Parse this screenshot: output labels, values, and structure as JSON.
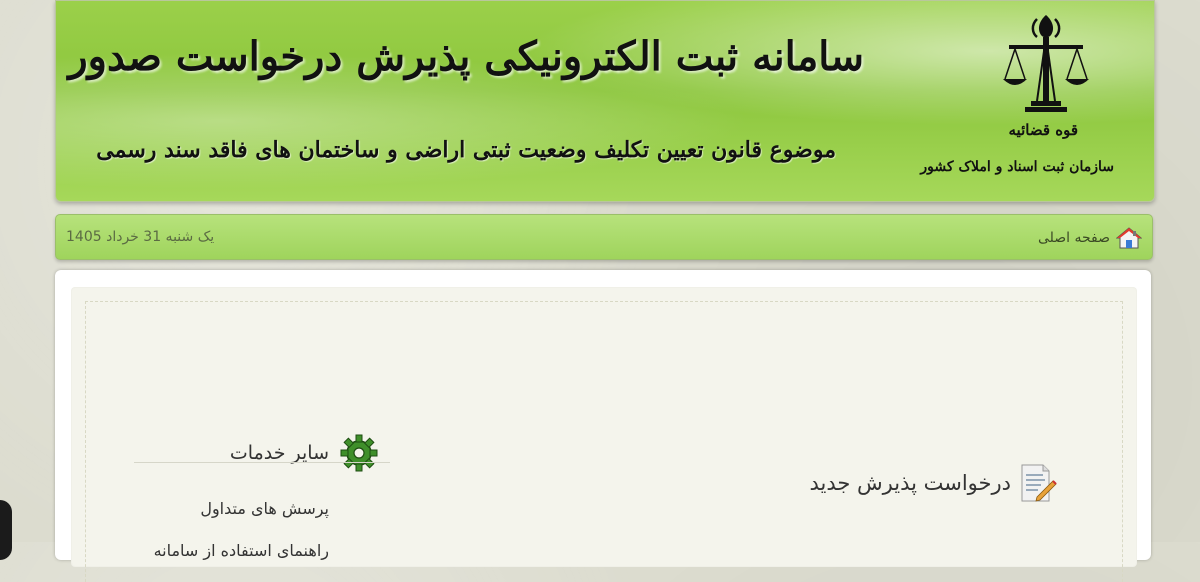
{
  "header": {
    "title": "سامانه ثبت الکترونیکی پذیرش درخواست صدور سند مالکیت",
    "subtitle": "موضوع قانون تعیین تکلیف وضعیت ثبتی اراضی و ساختمان های فاقد سند رسمی",
    "emblem_line1": "قوه قضائیه",
    "emblem_line2": "سازمان ثبت اسناد و املاک کشور"
  },
  "nav": {
    "home_label": "صفحه اصلی",
    "date": "یک شنبه 31 خرداد 1405"
  },
  "content": {
    "new_request_label": "درخواست پذیرش جدید",
    "other_services_title": "سایر خدمات",
    "services": [
      {
        "label": "پرسش های متداول"
      },
      {
        "label": "راهنمای استفاده از سامانه"
      }
    ]
  },
  "colors": {
    "banner_green": "#8cc63c",
    "nav_green": "#a9db6a",
    "panel_bg": "#f4f4ec"
  },
  "icons": {
    "emblem": "scales-of-justice-icon",
    "home": "home-icon",
    "services": "gear-icon",
    "new_request": "document-edit-icon"
  }
}
